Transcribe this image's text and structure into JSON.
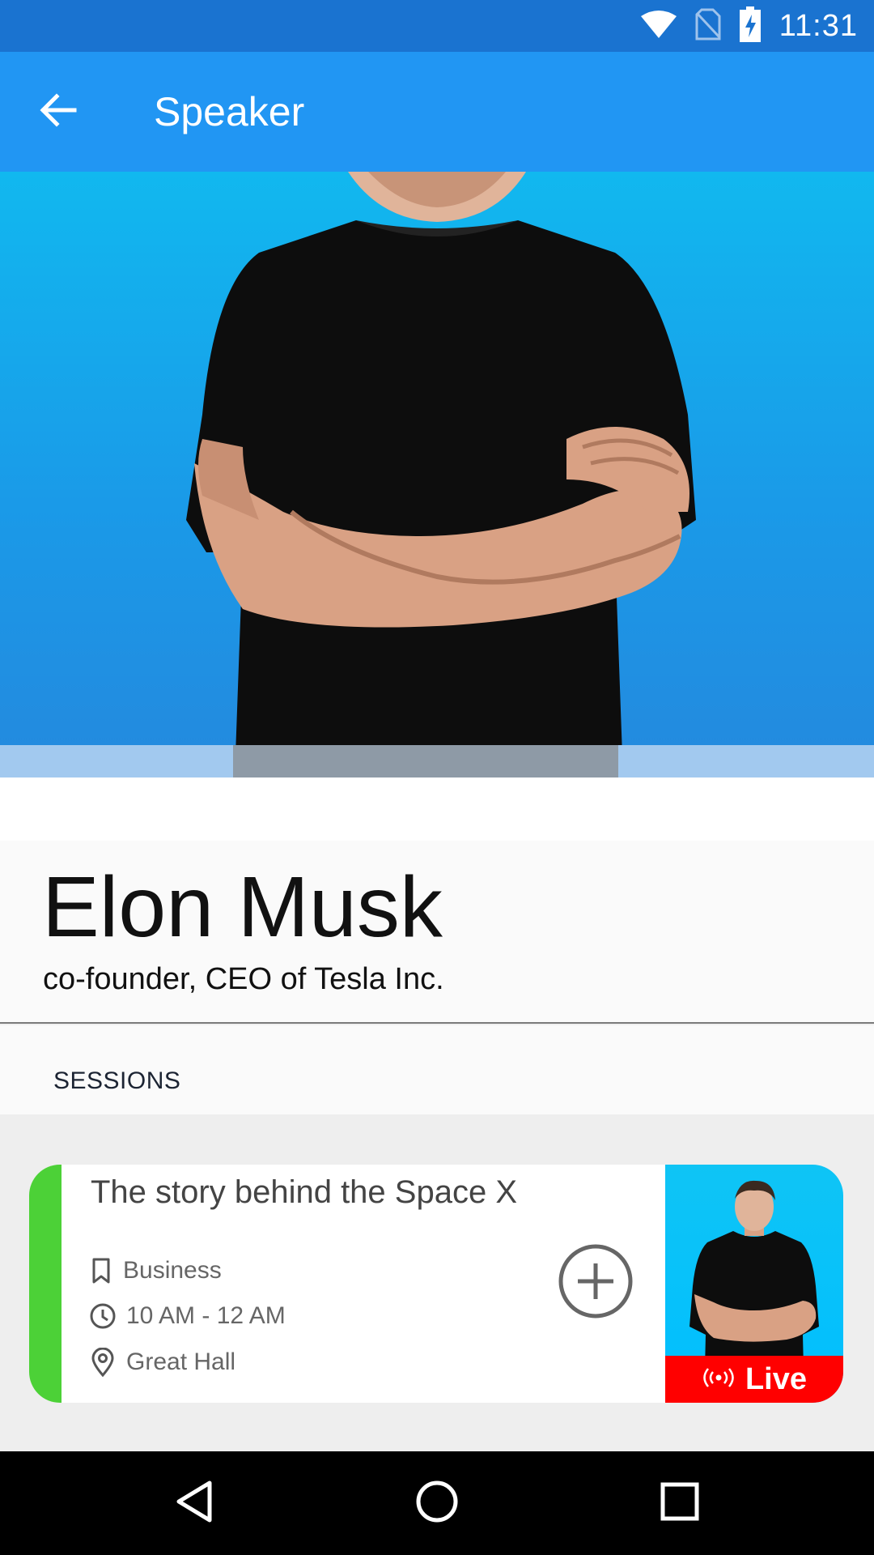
{
  "status_bar": {
    "time": "11:31",
    "icons": [
      "wifi-icon",
      "no-sim-icon",
      "battery-charging-icon"
    ]
  },
  "app_bar": {
    "title": "Speaker",
    "back_icon": "arrow-back-icon"
  },
  "speaker": {
    "name": "Elon Musk",
    "role": "co-founder, CEO of Tesla Inc."
  },
  "sessions": {
    "header": "SESSIONS",
    "items": [
      {
        "title": "The story behind the Space X",
        "track": "Business",
        "time": "10 AM - 12 AM",
        "location": "Great Hall",
        "live_label": "Live",
        "accent_color": "#4cd137"
      }
    ]
  },
  "colors": {
    "status_bar": "#1a73d0",
    "app_bar": "#2196f3",
    "live": "#ff0000"
  },
  "nav_bar": {
    "buttons": [
      "back-triangle-icon",
      "home-circle-icon",
      "recents-square-icon"
    ]
  }
}
